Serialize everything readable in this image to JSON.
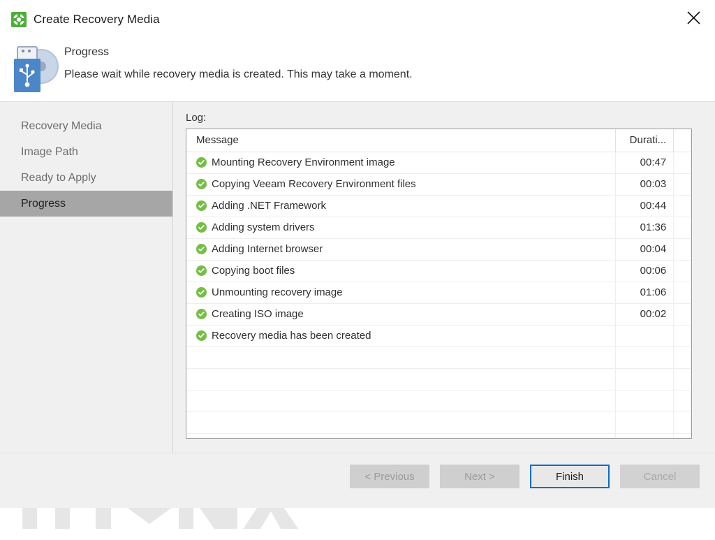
{
  "window": {
    "title": "Create Recovery Media",
    "title_icon": "veeam-lifebuoy-icon",
    "close_icon": "close-icon"
  },
  "header": {
    "icon": "usb-disc-media-icon",
    "title": "Progress",
    "subtitle": "Please wait while recovery media is created. This may take a moment."
  },
  "sidebar": {
    "items": [
      {
        "label": "Recovery Media",
        "active": false
      },
      {
        "label": "Image Path",
        "active": false
      },
      {
        "label": "Ready to Apply",
        "active": false
      },
      {
        "label": "Progress",
        "active": true
      }
    ]
  },
  "main": {
    "log_label": "Log:",
    "columns": [
      "Message",
      "Durati...",
      ""
    ],
    "rows": [
      {
        "status_icon": "success-check-icon",
        "message": "Mounting Recovery Environment image",
        "duration": "00:47"
      },
      {
        "status_icon": "success-check-icon",
        "message": "Copying Veeam Recovery Environment files",
        "duration": "00:03"
      },
      {
        "status_icon": "success-check-icon",
        "message": "Adding .NET Framework",
        "duration": "00:44"
      },
      {
        "status_icon": "success-check-icon",
        "message": "Adding system drivers",
        "duration": "01:36"
      },
      {
        "status_icon": "success-check-icon",
        "message": "Adding Internet browser",
        "duration": "00:04"
      },
      {
        "status_icon": "success-check-icon",
        "message": "Copying boot files",
        "duration": "00:06"
      },
      {
        "status_icon": "success-check-icon",
        "message": "Unmounting recovery image",
        "duration": "01:06"
      },
      {
        "status_icon": "success-check-icon",
        "message": "Creating ISO image",
        "duration": "00:02"
      },
      {
        "status_icon": "success-check-icon",
        "message": "Recovery media has been created",
        "duration": ""
      }
    ]
  },
  "watermark": {
    "text": "HYUNIX"
  },
  "footer": {
    "buttons": [
      {
        "label": "< Previous",
        "state": "disabled"
      },
      {
        "label": "Next >",
        "state": "disabled"
      },
      {
        "label": "Finish",
        "state": "primary"
      },
      {
        "label": "Cancel",
        "state": "cancel"
      }
    ]
  },
  "colors": {
    "accent": "#0a6cc4",
    "success": "#73bf44",
    "brand_green": "#4caf38",
    "usb_blue": "#4a86c8"
  }
}
